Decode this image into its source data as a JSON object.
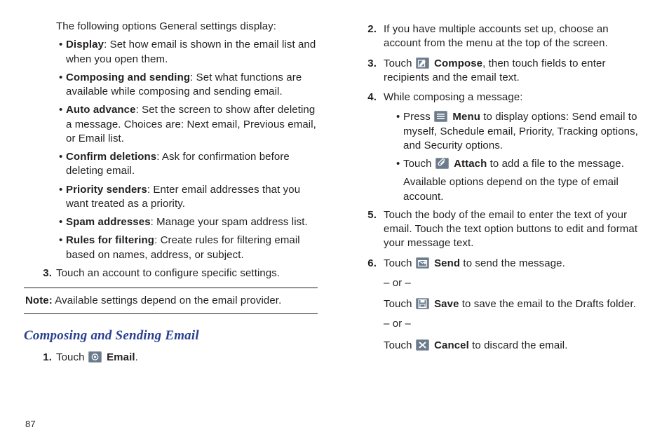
{
  "page_number": "87",
  "left": {
    "intro": "The following options General settings display:",
    "bullets": [
      {
        "term": "Display",
        "desc": ": Set how email is shown in the email list and when you open them."
      },
      {
        "term": "Composing and sending",
        "desc": ": Set what functions are available while composing and sending email."
      },
      {
        "term": "Auto advance",
        "desc": ": Set the screen to show after deleting a message. Choices are: Next email, Previous email, or Email list."
      },
      {
        "term": "Confirm deletions",
        "desc": ": Ask for confirmation before deleting email."
      },
      {
        "term": "Priority senders",
        "desc": ": Enter email addresses that you want treated as a priority."
      },
      {
        "term": "Spam addresses",
        "desc": ": Manage your spam address list."
      },
      {
        "term": "Rules for filtering",
        "desc": ": Create rules for filtering email based on names, address, or subject."
      }
    ],
    "step3": "Touch an account to configure specific settings.",
    "note_label": "Note:",
    "note_text": " Available settings depend on the email provider.",
    "heading": "Composing and Sending Email",
    "s1_a": "Touch ",
    "s1_b": "Email",
    "s1_c": "."
  },
  "right": {
    "s2": "If you have multiple accounts set up, choose an account from the menu at the top of the screen.",
    "s3_a": "Touch ",
    "s3_b": "Compose",
    "s3_c": ", then touch fields to enter recipients and the email text.",
    "s4": "While composing a message:",
    "s4b1_a": "Press ",
    "s4b1_b": "Menu",
    "s4b1_c": " to display options: Send email to myself, Schedule email, Priority, Tracking options, and Security options.",
    "s4b2_a": "Touch ",
    "s4b2_b": "Attach",
    "s4b2_c": " to add a file to the message.",
    "s4b2_d": "Available options depend on the type of email account.",
    "s5": "Touch the body of the email to enter the text of your email. Touch the text option buttons to edit and format your message text.",
    "s6_a": "Touch ",
    "s6_b": "Send",
    "s6_c": " to send the message.",
    "or": "– or –",
    "s6d_a": "Touch ",
    "s6d_b": "Save",
    "s6d_c": " to save the email to the Drafts folder.",
    "s6e_a": "Touch ",
    "s6e_b": "Cancel",
    "s6e_c": " to discard the email."
  },
  "nums": {
    "n1": "1.",
    "n2": "2.",
    "n3": "3.",
    "n4": "4.",
    "n5": "5.",
    "n6": "6."
  }
}
